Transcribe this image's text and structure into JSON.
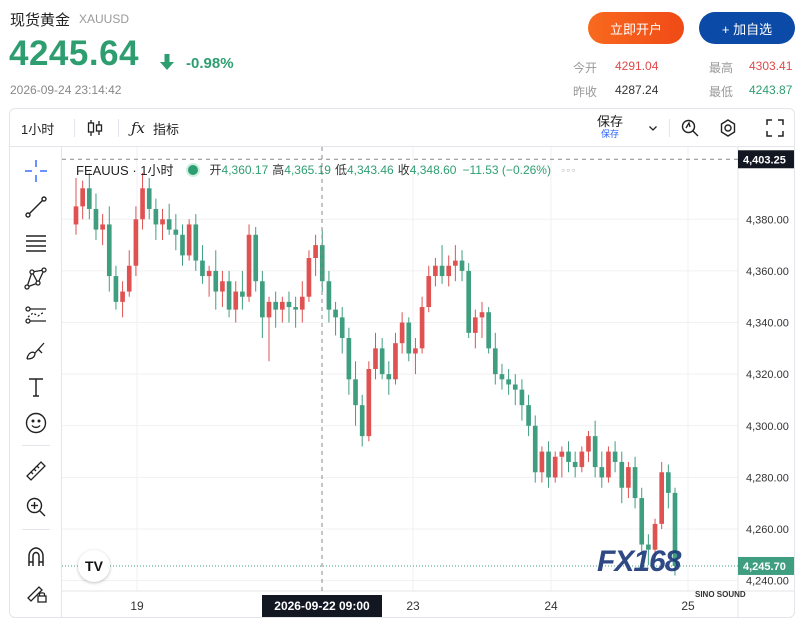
{
  "header": {
    "title": "现货黄金",
    "symbol": "XAUUSD",
    "price": "4245.64",
    "change_pct": "-0.98%",
    "timestamp": "2026-09-24 23:14:42",
    "open_account_label": "立即开户",
    "add_favorite_label": "+ 加自选",
    "quotes": {
      "today_open_label": "今开",
      "today_open": "4291.04",
      "high_label": "最高",
      "high": "4303.41",
      "prev_close_label": "昨收",
      "prev_close": "4287.24",
      "low_label": "最低",
      "low": "4243.87"
    }
  },
  "toolbar": {
    "interval": "1小时",
    "indicators_label": "指标",
    "save_label": "保存",
    "save_sub": "保存"
  },
  "legend": {
    "symbol": "FEAUUS · 1小时",
    "open_label": "开",
    "open": "4,360.17",
    "high_label": "高",
    "high": "4,365.19",
    "low_label": "低",
    "low": "4,343.46",
    "close_label": "收",
    "close": "4,348.60",
    "change": "−11.53 (−0.26%)"
  },
  "colors": {
    "up": "#e05252",
    "down": "#3f9e80",
    "accent": "#2962ff"
  },
  "watermark": "FX168",
  "brand_small": "SINO SOUND",
  "chart_data": {
    "type": "candlestick",
    "y_ticks": [
      "4,380.00",
      "4,360.00",
      "4,340.00",
      "4,320.00",
      "4,300.00",
      "4,280.00",
      "4,260.00",
      "4,240.00"
    ],
    "ylim": [
      4236,
      4408
    ],
    "x_ticks": [
      "19",
      "23",
      "24",
      "25"
    ],
    "crosshair_time": "2026-09-22  09:00",
    "crosshair_price": "4,403.25",
    "last_price": "4,245.70",
    "last_price_value": 4245.7,
    "crosshair_price_value": 4403.25,
    "candles": [
      [
        4378,
        4396,
        4374,
        4385
      ],
      [
        4385,
        4395,
        4380,
        4392
      ],
      [
        4392,
        4398,
        4380,
        4384
      ],
      [
        4384,
        4390,
        4372,
        4376
      ],
      [
        4376,
        4382,
        4370,
        4378
      ],
      [
        4378,
        4385,
        4352,
        4358
      ],
      [
        4358,
        4362,
        4345,
        4348
      ],
      [
        4348,
        4356,
        4342,
        4352
      ],
      [
        4352,
        4368,
        4350,
        4362
      ],
      [
        4362,
        4385,
        4358,
        4380
      ],
      [
        4380,
        4398,
        4376,
        4392
      ],
      [
        4392,
        4396,
        4380,
        4384
      ],
      [
        4384,
        4388,
        4372,
        4378
      ],
      [
        4378,
        4384,
        4372,
        4380
      ],
      [
        4380,
        4386,
        4374,
        4376
      ],
      [
        4376,
        4382,
        4368,
        4374
      ],
      [
        4374,
        4378,
        4362,
        4366
      ],
      [
        4366,
        4380,
        4364,
        4378
      ],
      [
        4378,
        4382,
        4360,
        4364
      ],
      [
        4364,
        4370,
        4355,
        4358
      ],
      [
        4358,
        4362,
        4350,
        4360
      ],
      [
        4360,
        4368,
        4345,
        4352
      ],
      [
        4352,
        4360,
        4346,
        4356
      ],
      [
        4356,
        4360,
        4342,
        4345
      ],
      [
        4345,
        4356,
        4340,
        4352
      ],
      [
        4352,
        4360,
        4345,
        4350
      ],
      [
        4350,
        4378,
        4348,
        4374
      ],
      [
        4374,
        4377,
        4352,
        4356
      ],
      [
        4356,
        4360,
        4334,
        4342
      ],
      [
        4342,
        4350,
        4325,
        4348
      ],
      [
        4348,
        4352,
        4338,
        4345
      ],
      [
        4345,
        4350,
        4340,
        4348
      ],
      [
        4348,
        4352,
        4340,
        4346
      ],
      [
        4346,
        4350,
        4338,
        4345
      ],
      [
        4345,
        4356,
        4340,
        4350
      ],
      [
        4350,
        4368,
        4348,
        4365
      ],
      [
        4365,
        4374,
        4358,
        4370
      ],
      [
        4370,
        4376,
        4352,
        4356
      ],
      [
        4356,
        4360,
        4340,
        4345
      ],
      [
        4345,
        4348,
        4335,
        4342
      ],
      [
        4342,
        4346,
        4328,
        4334
      ],
      [
        4334,
        4338,
        4312,
        4318
      ],
      [
        4318,
        4325,
        4300,
        4308
      ],
      [
        4308,
        4312,
        4292,
        4296
      ],
      [
        4296,
        4325,
        4294,
        4322
      ],
      [
        4322,
        4336,
        4318,
        4330
      ],
      [
        4330,
        4334,
        4318,
        4320
      ],
      [
        4320,
        4325,
        4312,
        4318
      ],
      [
        4318,
        4336,
        4316,
        4332
      ],
      [
        4332,
        4344,
        4328,
        4340
      ],
      [
        4340,
        4342,
        4325,
        4328
      ],
      [
        4328,
        4334,
        4320,
        4330
      ],
      [
        4330,
        4350,
        4328,
        4346
      ],
      [
        4346,
        4362,
        4344,
        4358
      ],
      [
        4358,
        4365,
        4354,
        4362
      ],
      [
        4362,
        4370,
        4355,
        4358
      ],
      [
        4358,
        4366,
        4354,
        4362
      ],
      [
        4362,
        4370,
        4356,
        4364
      ],
      [
        4364,
        4368,
        4356,
        4360
      ],
      [
        4360,
        4363,
        4334,
        4336
      ],
      [
        4336,
        4345,
        4330,
        4342
      ],
      [
        4342,
        4348,
        4334,
        4344
      ],
      [
        4344,
        4346,
        4328,
        4330
      ],
      [
        4330,
        4336,
        4316,
        4320
      ],
      [
        4320,
        4324,
        4314,
        4318
      ],
      [
        4318,
        4322,
        4312,
        4316
      ],
      [
        4316,
        4320,
        4308,
        4314
      ],
      [
        4314,
        4318,
        4302,
        4308
      ],
      [
        4308,
        4312,
        4296,
        4300
      ],
      [
        4300,
        4304,
        4278,
        4282
      ],
      [
        4282,
        4292,
        4278,
        4290
      ],
      [
        4290,
        4294,
        4276,
        4280
      ],
      [
        4280,
        4290,
        4278,
        4288
      ],
      [
        4288,
        4292,
        4280,
        4290
      ],
      [
        4290,
        4294,
        4282,
        4286
      ],
      [
        4286,
        4290,
        4280,
        4284
      ],
      [
        4284,
        4292,
        4282,
        4290
      ],
      [
        4290,
        4298,
        4286,
        4296
      ],
      [
        4296,
        4302,
        4280,
        4284
      ],
      [
        4284,
        4290,
        4276,
        4280
      ],
      [
        4280,
        4292,
        4278,
        4290
      ],
      [
        4290,
        4294,
        4282,
        4286
      ],
      [
        4286,
        4290,
        4270,
        4276
      ],
      [
        4276,
        4286,
        4272,
        4284
      ],
      [
        4284,
        4288,
        4268,
        4272
      ],
      [
        4272,
        4276,
        4250,
        4254
      ],
      [
        4254,
        4258,
        4246,
        4252
      ],
      [
        4252,
        4264,
        4248,
        4262
      ],
      [
        4262,
        4286,
        4260,
        4282
      ],
      [
        4282,
        4285,
        4268,
        4274
      ],
      [
        4274,
        4276,
        4242,
        4245.7
      ]
    ]
  }
}
